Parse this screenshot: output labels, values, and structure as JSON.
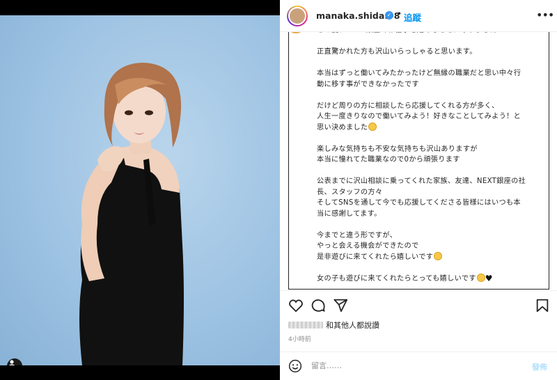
{
  "post": {
    "username": "manaka.shida.98",
    "separator": "•",
    "follow_label": "追蹤",
    "more_label": "•••"
  },
  "caption": {
    "lines": [
      "この度、NEXT銀座でお仕事を始めることになりました！",
      "",
      "正直驚かれた方も沢山いらっしゃると思います。",
      "",
      "本当はずっと働いてみたかったけど無縁の職業だと思い中々行",
      "動に移す事ができなかったです",
      "",
      "だけど周りの方に相談したら応援してくれる方が多く、",
      "人生一度きりなので働いてみよう！好きなことしてみよう！と",
      "思い決めました",
      "",
      "楽しみな気持ちも不安な気持ちも沢山ありますが",
      "本当に憧れてた職業なので0から頑張ります",
      "",
      "公表までに沢山相談に乗ってくれた家族、友達、NEXT銀座の社",
      "長、スタッフの方々",
      "そしてSNSを通して今でも応援してくださる皆様にはいつも本",
      "当に感謝してます。",
      "",
      "今までと違う形ですが、",
      "やっと会える機会ができたので",
      "是非遊びに来てくれたら嬉しいです",
      "",
      "女の子も遊びに来てくれたらとっても嬉しいです"
    ]
  },
  "engagement": {
    "likes_text": "和其他人都說讚",
    "time_ago": "4小時前"
  },
  "comment": {
    "placeholder": "留言……",
    "post_label": "發佈"
  },
  "colors": {
    "accent": "#0095f6",
    "verified": "#3897f0",
    "photo_background": "#9ec3e3"
  },
  "icons": [
    "user-tag-icon",
    "verified-icon",
    "more-icon",
    "heart-icon",
    "comment-icon",
    "share-icon",
    "bookmark-icon",
    "emoji-icon"
  ]
}
